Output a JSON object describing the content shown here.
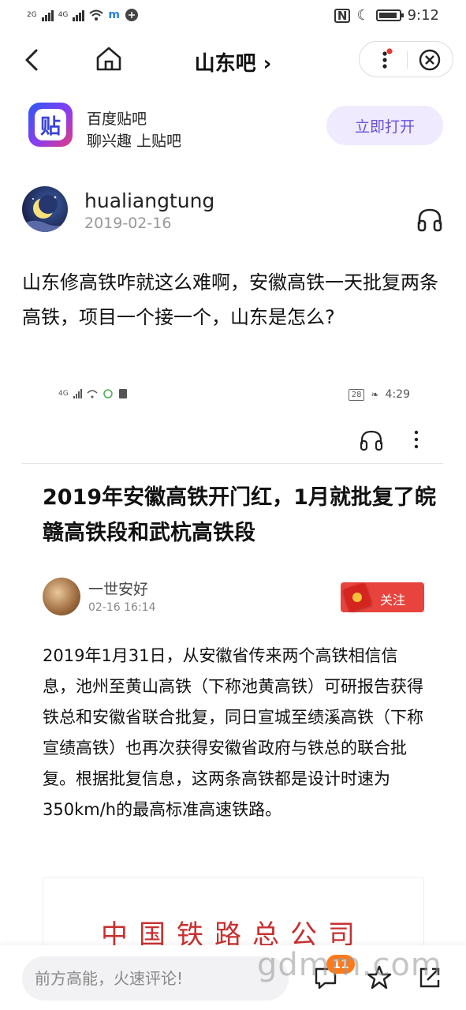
{
  "status_bar": {
    "net1": "2G",
    "net2": "4G",
    "time": "9:12"
  },
  "nav": {
    "title": "山东吧",
    "title_chevron": "›"
  },
  "banner": {
    "logo_char": "贴",
    "app_name": "百度贴吧",
    "slogan": "聊兴趣 上贴吧",
    "open_label": "立即打开"
  },
  "post": {
    "username": "hualiangtung",
    "date": "2019-02-16",
    "text": "山东修高铁咋就这么难啊，安徽高铁一天批复两条高铁，项目一个接一个，山东是怎么?"
  },
  "embedded": {
    "status_net": "4G",
    "battery": "28",
    "time": "4:29",
    "article_title": "2019年安徽高铁开门红，1月就批复了皖赣高铁段和武杭高铁段",
    "author": "一世安好",
    "author_time": "02-16 16:14",
    "follow_label": "关注",
    "body": "2019年1月31日，从安徽省传来两个高铁相信信息，池州至黄山高铁（下称池黄高铁）可研报告获得铁总和安徽省联合批复，同日宣城至绩溪高铁（下称宣绩高铁）也再次获得安徽省政府与铁总的联合批复。根据批复信息，这两条高铁都是设计时速为350km/h的最高标准高速铁路。",
    "image_text": "中国铁路总公司"
  },
  "bottom_bar": {
    "comment_placeholder": "前方高能，火速评论!",
    "comment_count": "11",
    "watermark": "gdmm.com"
  },
  "colors": {
    "accent": "#6b50d8",
    "follow_red": "#e8433c",
    "badge_orange": "#ff7a1a",
    "notify_dot": "#e53935"
  }
}
